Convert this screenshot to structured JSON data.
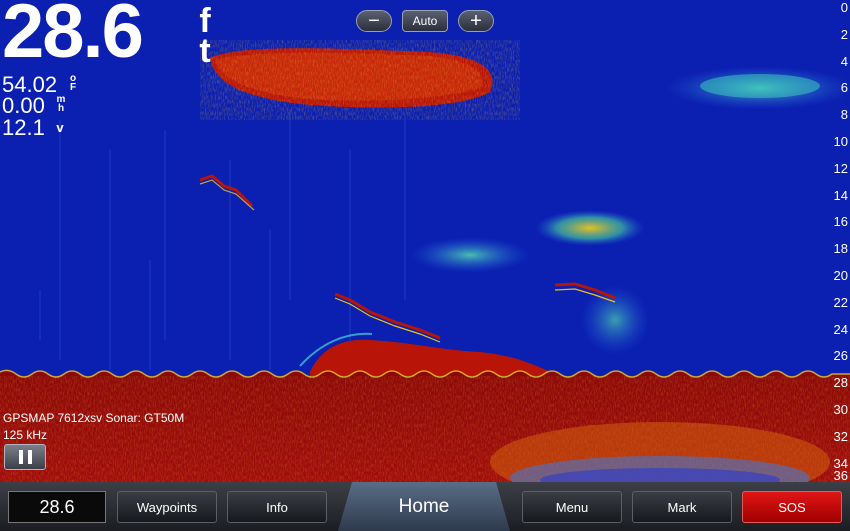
{
  "readouts": {
    "depth_value": "28.6",
    "depth_unit_top": "f",
    "depth_unit_bottom": "t",
    "water_temp": "54.02",
    "water_temp_unit_top": "o",
    "water_temp_unit_bottom": "F",
    "speed": "0.00",
    "speed_unit_top": "m",
    "speed_unit_bottom": "h",
    "voltage": "12.1",
    "voltage_unit": "v"
  },
  "zoom": {
    "minus_label": "−",
    "auto_label": "Auto",
    "plus_label": "+"
  },
  "depth_scale": [
    "0",
    "2",
    "4",
    "6",
    "8",
    "10",
    "12",
    "14",
    "16",
    "18",
    "20",
    "22",
    "24",
    "26",
    "28",
    "30",
    "32",
    "34",
    "36"
  ],
  "sonar": {
    "device_label": "GPSMAP 7612xsv Sonar: GT50M",
    "frequency": "125 kHz"
  },
  "bottom_bar": {
    "depth_display": "28.6",
    "waypoints_label": "Waypoints",
    "info_label": "Info",
    "home_label": "Home",
    "menu_label": "Menu",
    "mark_label": "Mark",
    "sos_label": "SOS"
  },
  "colors": {
    "water": "#0b1fb0",
    "bottom": "#9c0a0a",
    "sos": "#d01010"
  }
}
